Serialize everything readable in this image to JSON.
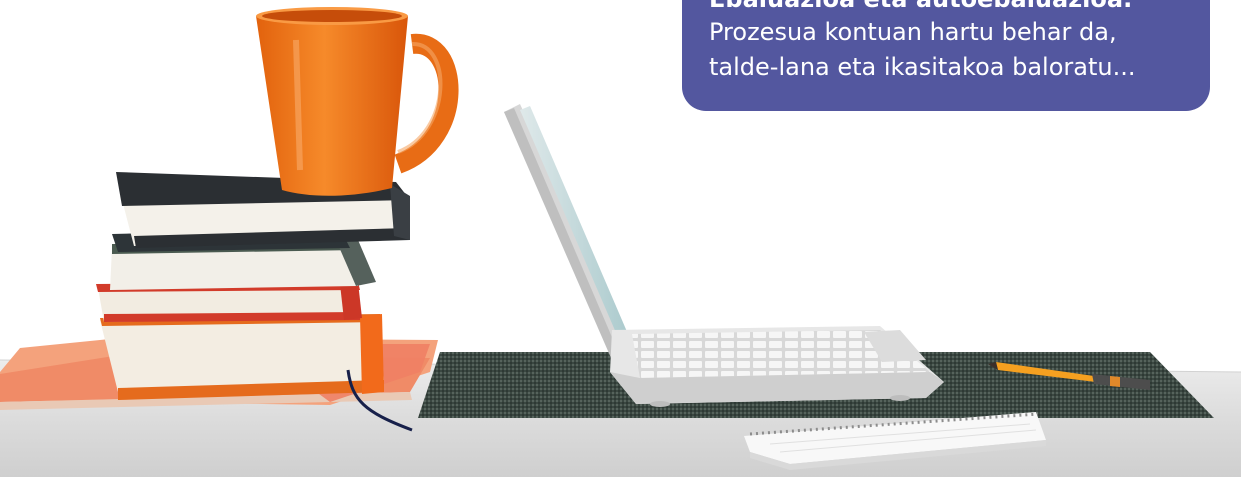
{
  "callout": {
    "heading": "Ebaluazioa eta autoebaluazioa.",
    "line1": "Prozesua kontuan hartu behar da,",
    "line2": "talde-lana eta ikasitakoa baloratu...",
    "background_color": "#53579f",
    "text_color": "#ffffff"
  },
  "photo": {
    "objects": [
      "orange-mug",
      "book-stack",
      "open-book",
      "laptop",
      "woven-mat",
      "pencil",
      "spiral-notebook"
    ],
    "mug_color": "#f07c1e",
    "mat_color": "#3c4a43"
  }
}
